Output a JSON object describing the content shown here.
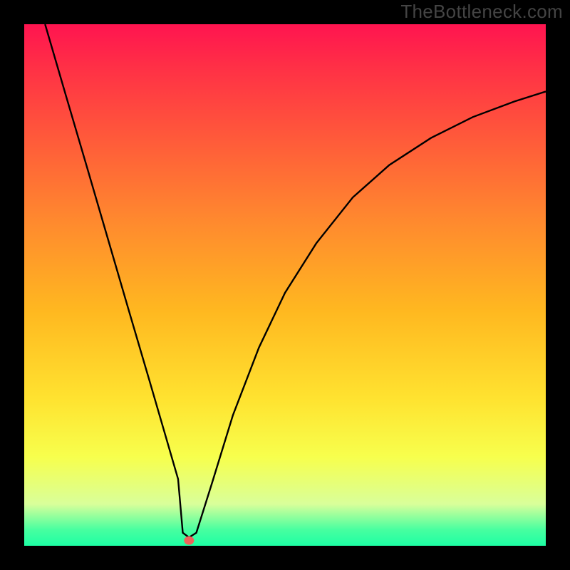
{
  "watermark": "TheBottleneck.com",
  "colors": {
    "background": "#000000",
    "curve": "#000000",
    "marker": "#ee625a",
    "gradient_top": "#ff1450",
    "gradient_bottom": "#1effa4"
  },
  "chart_data": {
    "type": "line",
    "title": "",
    "xlabel": "",
    "ylabel": "",
    "xlim": [
      0,
      100
    ],
    "ylim": [
      0,
      100
    ],
    "grid": false,
    "legend": false,
    "series": [
      {
        "name": "bottleneck-curve",
        "x": [
          4,
          8,
          12,
          16,
          20,
          24,
          27,
          29.5,
          30.4,
          31.6,
          33,
          36,
          40,
          45,
          50,
          56,
          63,
          70,
          78,
          86,
          94,
          100
        ],
        "values": [
          100,
          86.3,
          72.7,
          59.0,
          45.3,
          31.7,
          21.4,
          12.8,
          2.5,
          1.6,
          2.5,
          12,
          25,
          38,
          48.5,
          58,
          66.8,
          73,
          78.2,
          82.2,
          85.2,
          87.1
        ]
      }
    ],
    "marker": {
      "x": 31.6,
      "y": 1.0
    },
    "notes": "Values are estimated from the figure. y=0 is optimum (no bottleneck), y increases upward. Curve crosses x≈30.4 with a near-vertical drop to the minimum near x≈31.6."
  }
}
